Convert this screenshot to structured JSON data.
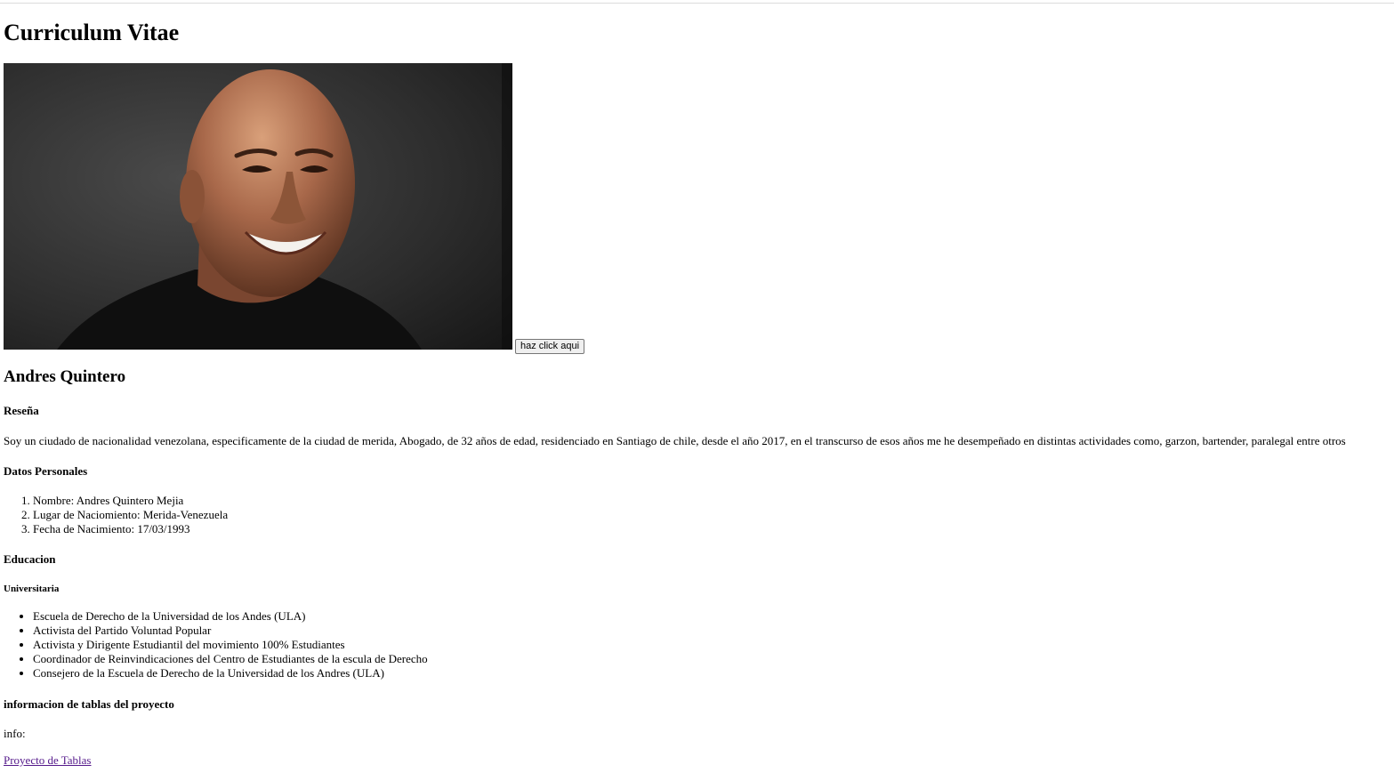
{
  "page": {
    "title": "Curriculum Vitae",
    "photo_alt": "profile-photo",
    "click_button": "haz click aqui",
    "name": "Andres Quintero"
  },
  "resena": {
    "heading": "Reseña",
    "text": "Soy un ciudado de nacionalidad venezolana, especificamente de la ciudad de merida, Abogado, de 32 años de edad, residenciado en Santiago de chile, desde el año 2017, en el transcurso de esos años me he desempeñado en distintas actividades como, garzon, bartender, paralegal entre otros"
  },
  "datos": {
    "heading": "Datos Personales",
    "items": [
      "Nombre: Andres Quintero Mejia",
      "Lugar de Naciomiento: Merida-Venezuela",
      "Fecha de Nacimiento: 17/03/1993"
    ]
  },
  "educacion": {
    "heading": "Educacion",
    "subheading": "Universitaria",
    "items": [
      "Escuela de Derecho de la Universidad de los Andes (ULA)",
      "Activista del Partido Voluntad Popular",
      "Activista y Dirigente Estudiantil del movimiento 100% Estudiantes",
      "Coordinador de Reinvindicaciones del Centro de Estudiantes de la escula de Derecho",
      "Consejero de la Escuela de Derecho de la Universidad de los Andres (ULA)"
    ]
  },
  "tablas": {
    "heading": "informacion de tablas del proyecto",
    "info": "info:",
    "link": "Proyecto de Tablas"
  }
}
